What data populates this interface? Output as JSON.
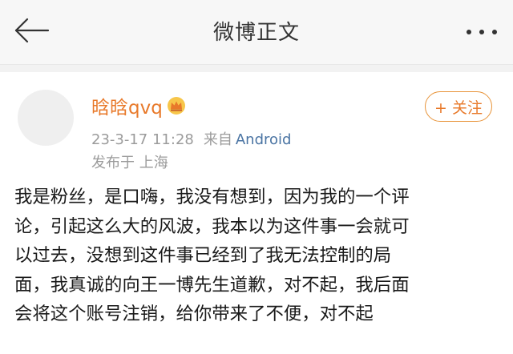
{
  "nav": {
    "title": "微博正文",
    "back_icon": "arrow-left-icon",
    "more_icon": "more-dots-icon"
  },
  "post": {
    "author": {
      "name": "晗晗qvq",
      "badge_icon": "crown-icon"
    },
    "follow_label": "+ 关注",
    "timestamp": "23-3-17 11:28",
    "source_label": "来自",
    "source_client": "Android",
    "location": "发布于 上海",
    "content_lines": [
      "我是粉丝，是口嗨，我没有想到，因为我的一个评",
      "论，引起这么大的风波，我本以为这件事一会就可",
      "以过去，没想到这件事已经到了我无法控制的局",
      "面，我真诚的向王一博先生道歉，对不起，我后面",
      "会将这个账号注销，给你带来了不便，对不起"
    ]
  },
  "colors": {
    "accent": "#e8792a",
    "link": "#4a74a3",
    "meta": "#9b9b9b"
  }
}
